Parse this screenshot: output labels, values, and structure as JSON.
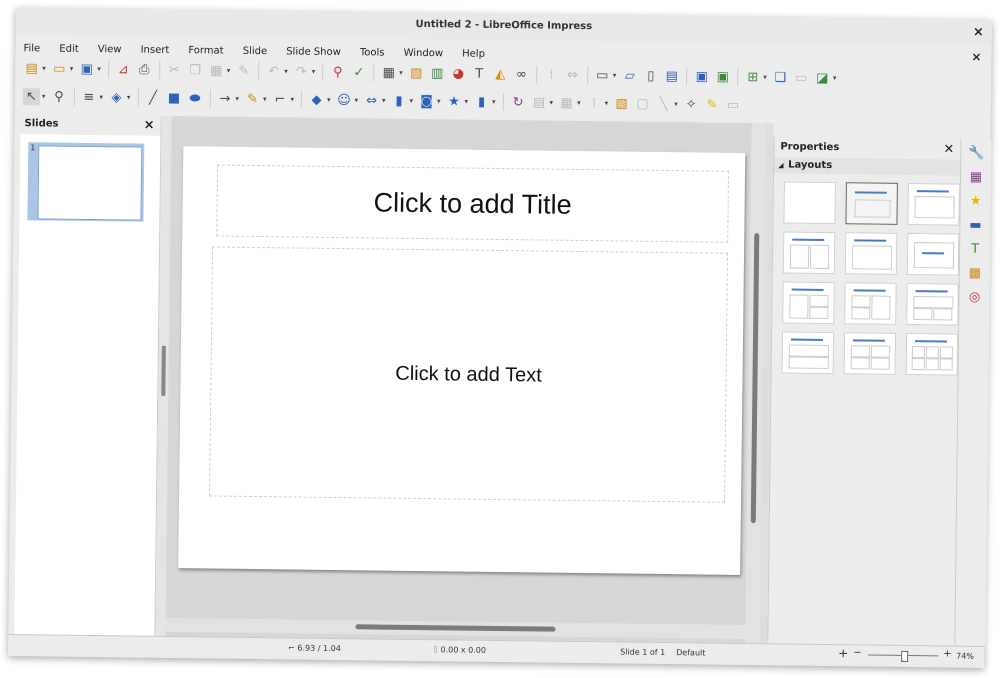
{
  "window": {
    "title": "Untitled 2 - LibreOffice Impress",
    "close_glyph": "×"
  },
  "menu": [
    "File",
    "Edit",
    "View",
    "Insert",
    "Format",
    "Slide",
    "Slide Show",
    "Tools",
    "Window",
    "Help"
  ],
  "slides_pane": {
    "title": "Slides",
    "close_glyph": "×",
    "thumb_number": "1"
  },
  "slide": {
    "title_placeholder": "Click to add Title",
    "body_placeholder": "Click to add Text"
  },
  "properties": {
    "title": "Properties",
    "close_glyph": "×",
    "layouts_label": "Layouts",
    "expand_glyph": "◢"
  },
  "status": {
    "position": "6.93 / 1.04",
    "size": "0.00 x 0.00",
    "slide": "Slide 1 of 1",
    "master": "Default",
    "zoom": "74%"
  },
  "icons": {
    "toolbar1": [
      "new-icon",
      "open-icon",
      "save-icon",
      "export-pdf-icon",
      "print-icon",
      "cut-icon",
      "copy-icon",
      "paste-icon",
      "clone-icon",
      "undo-icon",
      "redo-icon",
      "find-replace-icon",
      "spelling-icon",
      "table-icon",
      "image-icon",
      "media-icon",
      "chart-icon",
      "textbox-icon",
      "fontwork-icon",
      "special-char-icon",
      "grid-icon",
      "helplines-icon",
      "display-views-icon",
      "master-slide-icon",
      "new-slide-icon",
      "slide-layout-icon",
      "start-show-icon",
      "show-current-icon",
      "insert-slide-icon",
      "duplicate-icon",
      "delete-slide-icon",
      "slide-design-icon"
    ],
    "toolbar2": [
      "select-icon",
      "zoom-icon",
      "line-color-icon",
      "fill-color-icon",
      "line-icon",
      "rectangle-icon",
      "ellipse-icon",
      "arrow-icon",
      "curve-icon",
      "connector-icon",
      "basic-shapes-icon",
      "symbol-shapes-icon",
      "block-arrows-icon",
      "flowchart-icon",
      "callouts-icon",
      "stars-icon",
      "3d-objects-icon",
      "rotate-icon",
      "align-icon",
      "arrange-icon",
      "distribute-icon",
      "group-icon",
      "shadow-icon",
      "crop-icon",
      "points-icon",
      "glue-icon",
      "filter-icon"
    ]
  }
}
